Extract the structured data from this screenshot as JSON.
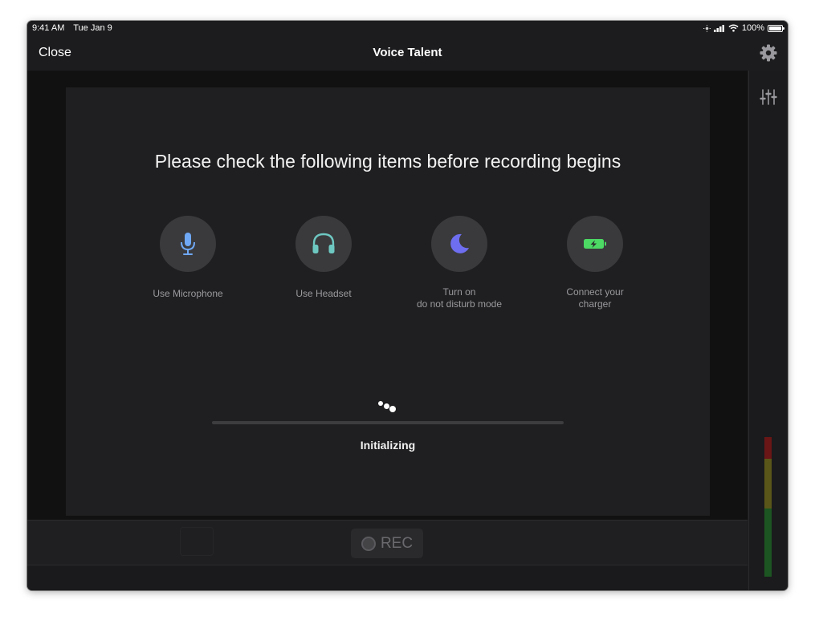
{
  "statusbar": {
    "time": "9:41 AM",
    "date": "Tue Jan 9",
    "battery_percent": "100%",
    "icons": [
      "brightness-icon",
      "signal-icon",
      "wifi-icon",
      "battery-icon"
    ]
  },
  "navbar": {
    "close_label": "Close",
    "title": "Voice Talent",
    "settings_icon": "gear-icon"
  },
  "overlay": {
    "heading": "Please check the following items before recording begins",
    "items": [
      {
        "label": "Use Microphone",
        "icon": "microphone-icon",
        "color": "#6fa8f5"
      },
      {
        "label": "Use Headset",
        "icon": "headphones-icon",
        "color": "#6ec8c2"
      },
      {
        "label": "Turn on\ndo not disturb mode",
        "icon": "moon-icon",
        "color": "#6e6ef0"
      },
      {
        "label": "Connect your\ncharger",
        "icon": "battery-charging-icon",
        "color": "#4cd964"
      }
    ],
    "status": "Initializing",
    "progress": 0
  },
  "sidepanel": {
    "mixer_icon": "sliders-icon",
    "meter_colors": [
      "#6a1616",
      "#5a5619",
      "#1c5521"
    ]
  },
  "recorder": {
    "rec_label": "REC"
  }
}
